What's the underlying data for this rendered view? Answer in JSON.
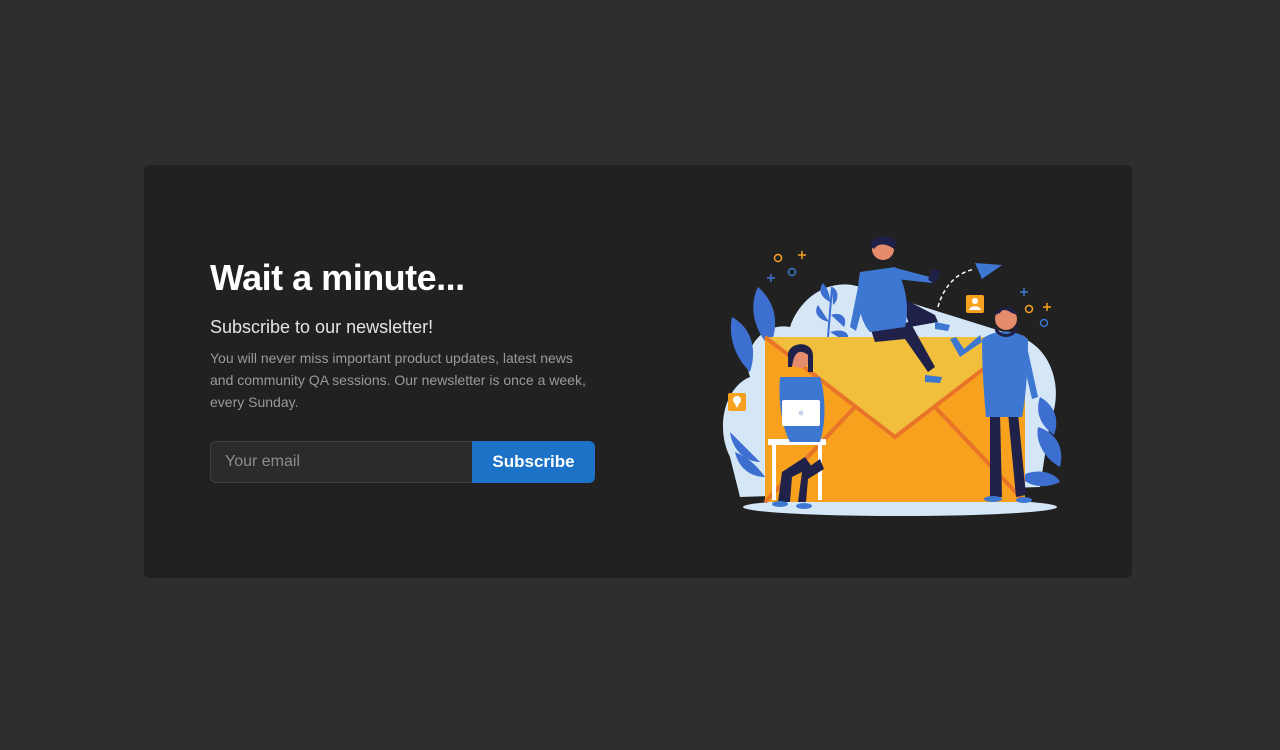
{
  "newsletter": {
    "title": "Wait a minute...",
    "subtitle": "Subscribe to our newsletter!",
    "description": "You will never miss important product updates, latest news and community QA sessions. Our newsletter is once a week, every Sunday.",
    "email_placeholder": "Your email",
    "subscribe_label": "Subscribe"
  },
  "colors": {
    "page_bg": "#2e2e2e",
    "card_bg": "#212121",
    "accent_blue": "#1b72c6",
    "envelope_orange": "#f7a11f",
    "envelope_flap": "#f1bf3c",
    "person_blue": "#3e77d2",
    "leaf_blue": "#3d6fd0",
    "cloud_light": "#d5e6f7"
  },
  "illustration": {
    "icons": [
      "envelope-icon",
      "paper-plane-icon",
      "location-pin-icon",
      "user-badge-icon",
      "laptop-icon",
      "phone-icon"
    ]
  }
}
